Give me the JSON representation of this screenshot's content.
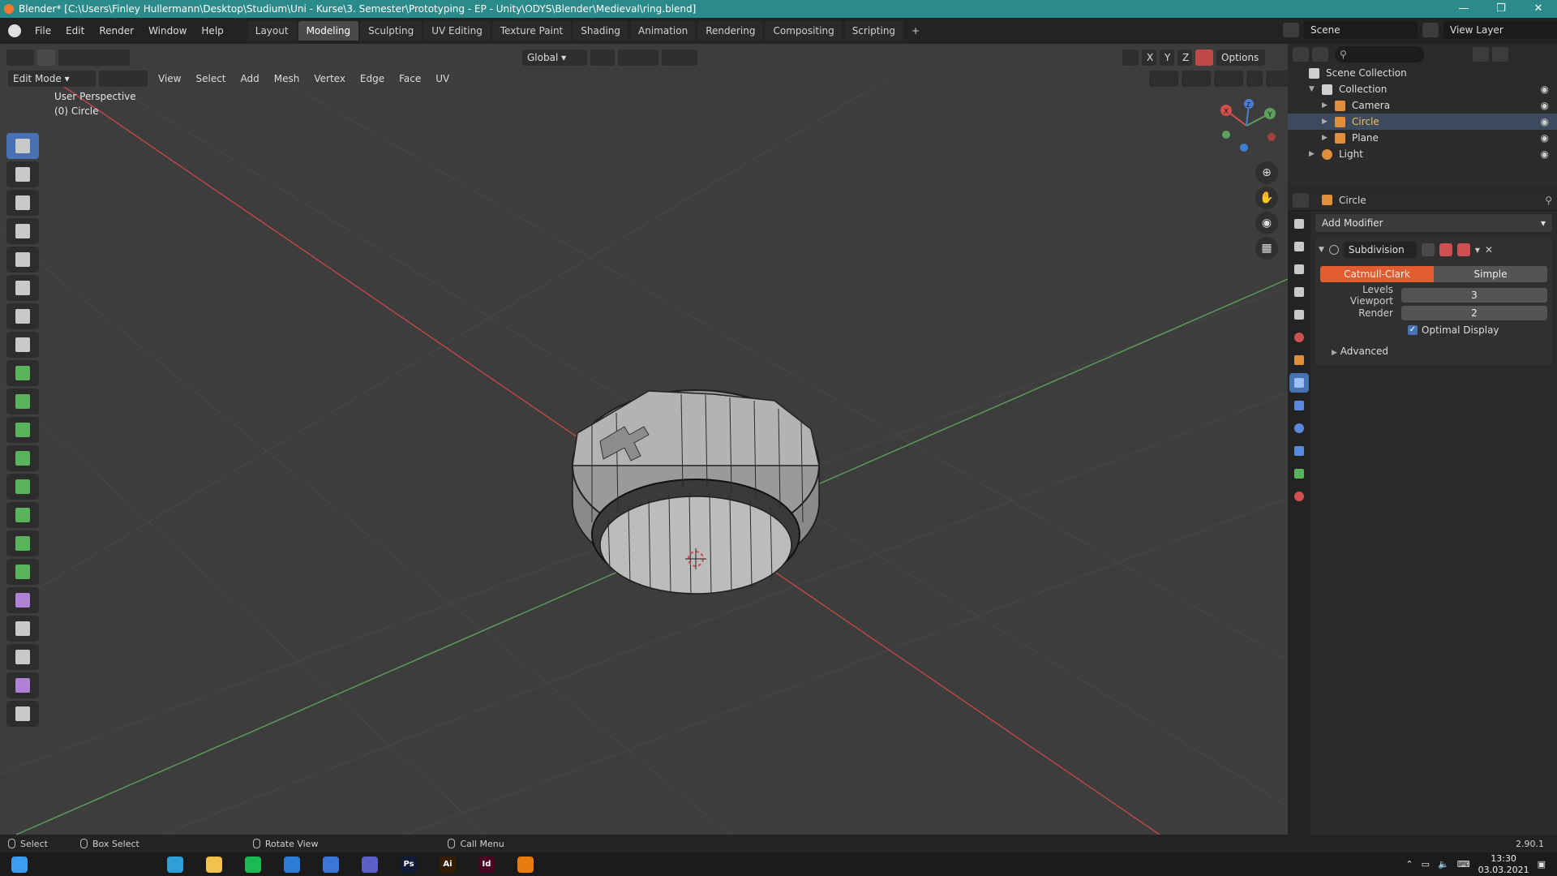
{
  "window": {
    "title": "Blender* [C:\\Users\\Finley Hullermann\\Desktop\\Studium\\Uni - Kurse\\3. Semester\\Prototyping - EP - Unity\\ODYS\\Blender\\Medieval\\ring.blend]",
    "controls": [
      "—",
      "❐",
      "✕"
    ]
  },
  "menubar": {
    "items": [
      "File",
      "Edit",
      "Render",
      "Window",
      "Help"
    ],
    "workspace_tabs": [
      "Layout",
      "Modeling",
      "Sculpting",
      "UV Editing",
      "Texture Paint",
      "Shading",
      "Animation",
      "Rendering",
      "Compositing",
      "Scripting"
    ],
    "active_tab": "Modeling",
    "add_tab": "+",
    "scene": "Scene",
    "view_layer": "View Layer"
  },
  "viewport": {
    "mode": "Edit Mode",
    "menus": [
      "View",
      "Select",
      "Add",
      "Mesh",
      "Vertex",
      "Edge",
      "Face",
      "UV"
    ],
    "orientation": "Global",
    "options": "Options",
    "axes": [
      "X",
      "Y",
      "Z"
    ],
    "perspective": "User Perspective",
    "object": "(0) Circle",
    "gizmo": {
      "x": "X",
      "y": "Y",
      "z": "Z"
    },
    "colors": {
      "x_axis": "#c04848",
      "y_axis": "#5da05d",
      "background": "#3d3d3d",
      "active_tool": "#4772b3"
    }
  },
  "tools": [
    "select-box-icon",
    "cursor-icon",
    "move-icon",
    "rotate-icon",
    "scale-icon",
    "transform-icon",
    "annotate-icon",
    "measure-icon",
    "add-cube-icon",
    "extrude-region-icon",
    "inset-faces-icon",
    "bevel-icon",
    "loop-cut-icon",
    "knife-icon",
    "poly-build-icon",
    "spin-icon",
    "smooth-icon",
    "edge-slide-icon",
    "shrink-fatten-icon",
    "shear-icon",
    "rip-region-icon"
  ],
  "outliner": {
    "root": "Scene Collection",
    "items": [
      {
        "label": "Collection",
        "icon": "collection-icon",
        "color": "#cfcfcf"
      },
      {
        "label": "Camera",
        "icon": "camera-icon",
        "color": "#e28f3d"
      },
      {
        "label": "Circle",
        "icon": "mesh-icon",
        "color": "#e28f3d",
        "selected": true
      },
      {
        "label": "Plane",
        "icon": "mesh-icon",
        "color": "#e28f3d"
      },
      {
        "label": "Light",
        "icon": "light-icon",
        "color": "#e28f3d"
      }
    ]
  },
  "properties": {
    "object_name": "Circle",
    "add_modifier": "Add Modifier",
    "modifier": {
      "name": "Subdivision",
      "algorithms": [
        "Catmull-Clark",
        "Simple"
      ],
      "active_algorithm": "Catmull-Clark",
      "levels_viewport_label": "Levels Viewport",
      "levels_viewport": "3",
      "render_label": "Render",
      "render": "2",
      "optimal_display_label": "Optimal Display",
      "optimal_display": true,
      "advanced_label": "Advanced"
    },
    "tabs": [
      {
        "name": "tool-icon",
        "color": "#c9c9c9"
      },
      {
        "name": "render-icon",
        "color": "#c9c9c9"
      },
      {
        "name": "output-icon",
        "color": "#c9c9c9"
      },
      {
        "name": "view-layer-icon",
        "color": "#c9c9c9"
      },
      {
        "name": "scene-icon",
        "color": "#c9c9c9"
      },
      {
        "name": "world-icon",
        "color": "#d05050"
      },
      {
        "name": "object-icon",
        "color": "#e28f3d"
      },
      {
        "name": "modifier-icon",
        "color": "#5a8ae0",
        "active": true
      },
      {
        "name": "particles-icon",
        "color": "#5a8ae0"
      },
      {
        "name": "physics-icon",
        "color": "#5a8ae0"
      },
      {
        "name": "constraints-icon",
        "color": "#5a8ae0"
      },
      {
        "name": "data-icon",
        "color": "#59b35a"
      },
      {
        "name": "material-icon",
        "color": "#d05050"
      }
    ]
  },
  "statusbar": {
    "items": [
      "Select",
      "Box Select",
      "Rotate View",
      "Call Menu"
    ],
    "version": "2.90.1"
  },
  "taskbar": {
    "time": "13:30",
    "date": "03.03.2021",
    "apps": [
      {
        "name": "windows-start-icon",
        "color": "#3b9cf0",
        "label": ""
      },
      {
        "name": "search-icon",
        "color": "#1b1b1b",
        "label": ""
      },
      {
        "name": "cortana-icon",
        "color": "#1b1b1b",
        "label": ""
      },
      {
        "name": "task-view-icon",
        "color": "#1b1b1b",
        "label": ""
      },
      {
        "name": "edge-icon",
        "color": "#2e9fd8",
        "label": ""
      },
      {
        "name": "explorer-icon",
        "color": "#f2c14e",
        "label": ""
      },
      {
        "name": "spotify-icon",
        "color": "#1db954",
        "label": ""
      },
      {
        "name": "mail-icon",
        "color": "#2d7cd6",
        "label": ""
      },
      {
        "name": "store-icon",
        "color": "#3a77d9",
        "label": ""
      },
      {
        "name": "teams-icon",
        "color": "#5b5fc7",
        "label": ""
      },
      {
        "name": "photoshop-icon",
        "color": "#0f1a36",
        "label": "Ps"
      },
      {
        "name": "illustrator-icon",
        "color": "#331c00",
        "label": "Ai"
      },
      {
        "name": "indesign-icon",
        "color": "#49021f",
        "label": "Id"
      },
      {
        "name": "blender-icon",
        "color": "#e87d0d",
        "label": ""
      }
    ]
  }
}
